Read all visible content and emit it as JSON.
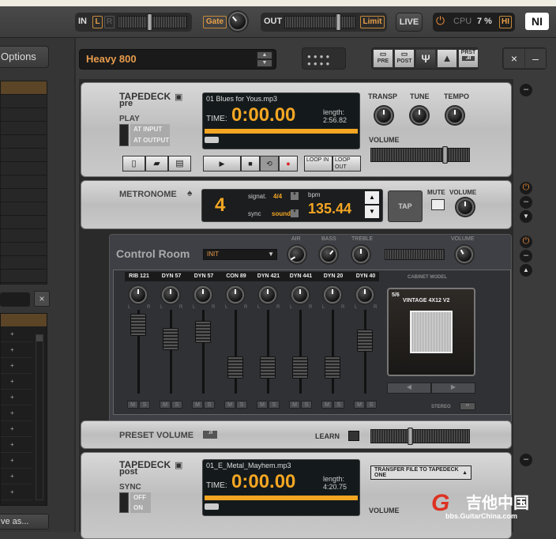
{
  "topbar": {
    "in_label": "IN",
    "in_l": "L",
    "in_r": "R",
    "gate_label": "Gate",
    "out_label": "OUT",
    "limit_label": "Limit",
    "live_label": "LIVE",
    "cpu_label": "CPU",
    "cpu_value": "7 %",
    "hi_label": "HI",
    "logo": "NI"
  },
  "sidebar": {
    "options_label": "Options",
    "clear_label": "×",
    "save_as_label": "ve as...",
    "list_rows": 15,
    "bank_rows": 11
  },
  "preset": {
    "name": "Heavy 800",
    "up": "▲",
    "down": "▼"
  },
  "toolbar": {
    "pre_label": "PRE",
    "post_label": "POST",
    "prst_label": "PRST",
    "close_label": "×",
    "minimize_label": "–"
  },
  "tapedeck_pre": {
    "title": "TAPEDECK",
    "subtitle": "pre",
    "play_label": "PLAY",
    "play_options": [
      "AT INPUT",
      "AT OUTPUT"
    ],
    "filename": "01 Blues for Yous.mp3",
    "time_label": "TIME:",
    "time": "0:00.00",
    "length_label": "length:",
    "length": "2:56.82",
    "loop_in": "LOOP IN",
    "loop_out": "LOOP OUT",
    "knobs": [
      "TRANSP",
      "TUNE",
      "TEMPO"
    ],
    "volume_label": "VOLUME",
    "volume_level": 0.78
  },
  "metronome": {
    "title": "METRONOME",
    "beat": "4",
    "signat_label": "signat.",
    "signat_value": "4/4",
    "sync_label": "sync",
    "sync_value": "sound",
    "bpm_label": "bpm",
    "bpm": "135.44",
    "tap_label": "TAP",
    "mute_label": "MUTE",
    "volume_label": "VOLUME"
  },
  "control_room": {
    "title": "Control Room",
    "preset": "INIT",
    "knobs": [
      "AIR",
      "BASS",
      "TREBLE"
    ],
    "volume_label": "VOLUME",
    "channels": [
      {
        "name": "RIB 121",
        "fader": 0.95
      },
      {
        "name": "DYN 57",
        "fader": 0.75
      },
      {
        "name": "DYN 57",
        "fader": 0.85
      },
      {
        "name": "CON 89",
        "fader": 0.35
      },
      {
        "name": "DYN 421",
        "fader": 0.35
      },
      {
        "name": "DYN 441",
        "fader": 0.35
      },
      {
        "name": "DYN 20",
        "fader": 0.35
      },
      {
        "name": "DYN 40",
        "fader": 0.72
      }
    ],
    "pan_l": "L",
    "pan_r": "R",
    "mute": "M",
    "solo": "S",
    "cabinet_label": "CABINET MODEL",
    "cabinet_index": "5/6",
    "cabinet_name": "VINTAGE 4X12 V2",
    "stereo_label": "STEREO"
  },
  "preset_volume": {
    "title": "PRESET VOLUME",
    "learn_label": "LEARN",
    "level": 0.4
  },
  "tapedeck_post": {
    "title": "TAPEDECK",
    "subtitle": "post",
    "sync_label": "SYNC",
    "sync_options": [
      "OFF",
      "ON"
    ],
    "filename": "01_E_Metal_Mayhem.mp3",
    "time_label": "TIME:",
    "time": "0:00.00",
    "length_label": "length:",
    "length": "4:20.75",
    "transfer_label": "TRANSFER FILE TO TAPEDECK ONE",
    "volume_label": "VOLUME"
  },
  "watermark": {
    "cn": "吉他中国",
    "url": "bbs.GuitarChina.com"
  }
}
